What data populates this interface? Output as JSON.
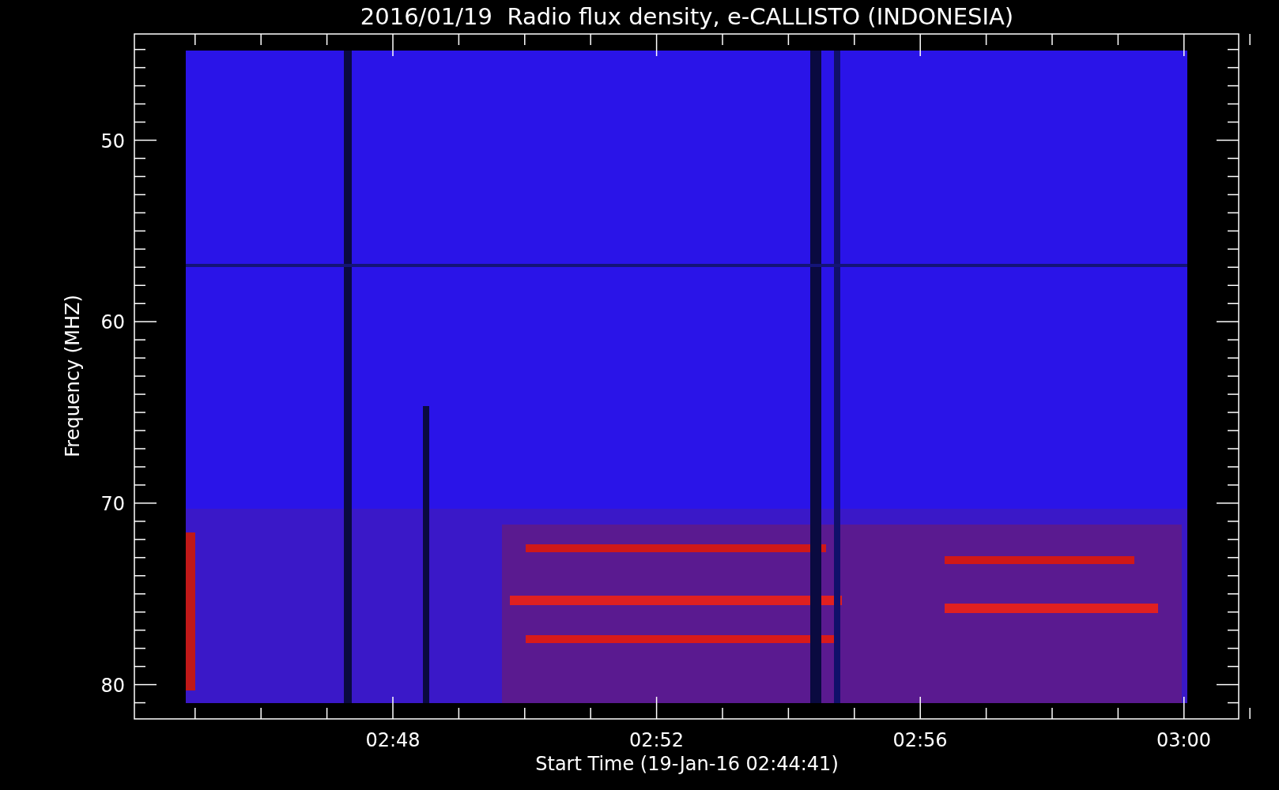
{
  "title": "2016/01/19  Radio flux density, e-CALLISTO (INDONESIA)",
  "y_axis": {
    "label": "Frequency (MHZ)",
    "ticks": [
      "50",
      "60",
      "70",
      "80"
    ]
  },
  "x_axis": {
    "label": "Start Time (19-Jan-16 02:44:41)",
    "ticks": [
      "02:48",
      "02:52",
      "02:56",
      "03:00"
    ]
  }
}
